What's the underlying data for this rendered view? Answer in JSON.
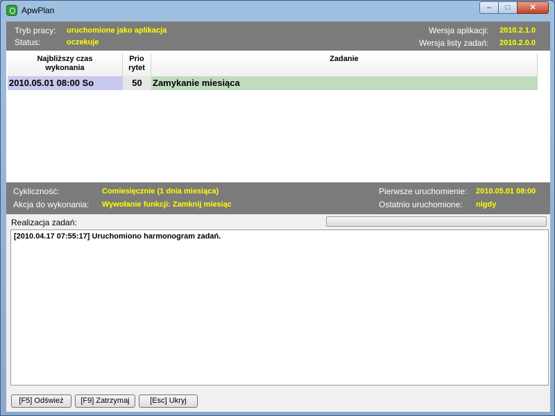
{
  "window": {
    "title": "ApwPlan",
    "min": "–",
    "max": "□",
    "close": "✕"
  },
  "info": {
    "mode_label": "Tryb pracy:",
    "mode_value": "uruchomione jako aplikacja",
    "status_label": "Status:",
    "status_value": "oczekuje",
    "app_version_label": "Wersja aplikacji:",
    "app_version_value": "2010.2.1.0",
    "tasklist_version_label": "Wersja listy zadań:",
    "tasklist_version_value": "2010.2.0.0"
  },
  "table": {
    "headers": [
      "Najbliższy czas\nwykonania",
      "Prio\nrytet",
      "Zadanie"
    ],
    "rows": [
      {
        "time": "2010.05.01 08:00  So",
        "priority": "50",
        "task": "Zamykanie miesiąca"
      }
    ]
  },
  "details": {
    "cycle_label": "Cykliczność:",
    "cycle_value": "Comiesięcznie (1 dnia miesiąca)",
    "action_label": "Akcja do wykonania:",
    "action_value": "Wywołanie funkcji: Zamknij miesiąc",
    "first_run_label": "Pierwsze uruchomienie:",
    "first_run_value": "2010.05.01 08:00",
    "last_run_label": "Ostatnio uruchomione:",
    "last_run_value": "nigdy"
  },
  "realization": {
    "label": "Realizacja zadań:",
    "progress": 0,
    "log": [
      "[2010.04.17 07:55:17] Uruchomiono harmonogram zadań."
    ]
  },
  "buttons": {
    "refresh": "[F5] Odśwież",
    "stop": "[F9] Zatrzymaj",
    "hide": "[Esc] Ukryj"
  },
  "colors": {
    "panel": "#7b7b7b",
    "value": "#ffff00",
    "time_cell": "#c8c8f0",
    "task_cell": "#c0dcc0"
  }
}
